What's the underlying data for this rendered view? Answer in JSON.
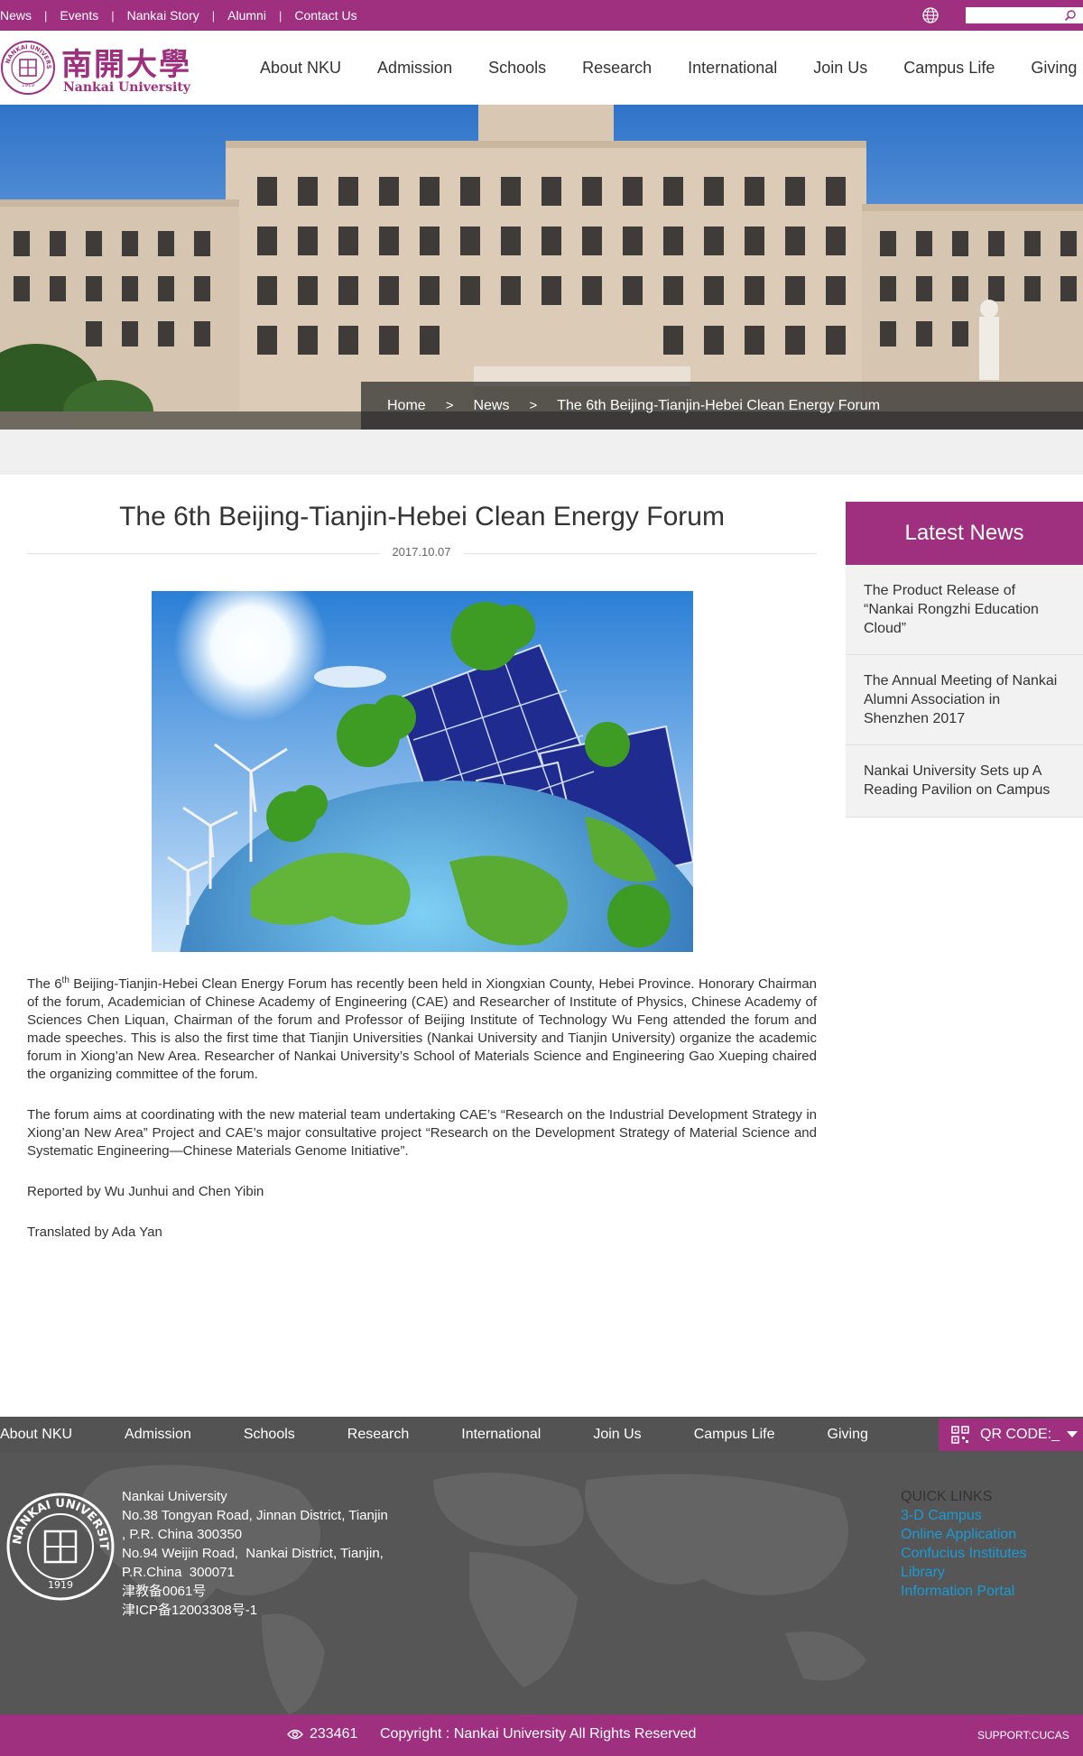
{
  "topbar": {
    "links": [
      "News",
      "Events",
      "Nankai Story",
      "Alumni",
      "Contact Us"
    ],
    "search_placeholder": ""
  },
  "header": {
    "logo_cn": "南開大學",
    "logo_en": "Nankai University",
    "seal_text": "NANKAI UNIVERSITY",
    "seal_year": "1919",
    "nav": [
      "About NKU",
      "Admission",
      "Schools",
      "Research",
      "International",
      "Join Us",
      "Campus Life",
      "Giving"
    ]
  },
  "breadcrumb": {
    "home": "Home",
    "sep1": ">",
    "section": "News",
    "sep2": ">",
    "current": "The 6th Beijing-Tianjin-Hebei Clean Energy Forum"
  },
  "article": {
    "title": "The 6th Beijing-Tianjin-Hebei Clean Energy Forum",
    "date": "2017.10.07",
    "p1_lead": "The 6",
    "p1_sup": "th",
    "p1_rest": " Beijing-Tianjin-Hebei Clean Energy Forum has recently been held in Xiongxian County, Hebei Province. Honorary Chairman of the forum, Academician of Chinese Academy of Engineering (CAE) and Researcher of Institute of Physics, Chinese Academy of Sciences Chen Liquan, Chairman of the forum and Professor of Beijing Institute of Technology Wu Feng attended the forum and made speeches. This is also the first time that Tianjin Universities (Nankai University and Tianjin University) organize the academic forum in Xiong’an New Area. Researcher of Nankai University’s School of Materials Science and Engineering Gao Xueping chaired the organizing committee of the forum.",
    "p2": "The forum aims at coordinating with the new material team undertaking CAE’s “Research on the Industrial Development Strategy in Xiong’an New Area” Project and CAE’s major consultative project “Research on the Development Strategy of Material Science and Systematic Engineering—Chinese Materials Genome Initiative”.",
    "reported_by": "Reported by Wu Junhui and Chen Yibin",
    "translated_by": "Translated by Ada Yan"
  },
  "sidebar": {
    "heading": "Latest News",
    "items": [
      "The Product Release of “Nankai Rongzhi Education Cloud”",
      "The Annual Meeting of Nankai Alumni Association in Shenzhen 2017",
      "Nankai University Sets up A Reading Pavilion on Campus"
    ]
  },
  "footer": {
    "nav": [
      "About NKU",
      "Admission",
      "Schools",
      "Research",
      "International",
      "Join Us",
      "Campus Life",
      "Giving"
    ],
    "qr_label": "QR CODE:_",
    "address": "Nankai University\nNo.38 Tongyan Road, Jinnan District, Tianjin\n, P.R. China 300350\nNo.94 Weijin Road,  Nankai District, Tianjin,\nP.R.China  300071\n津教备0061号\n津ICP备12003308号-1",
    "quick_links_title": "QUICK LINKS",
    "quick_links": [
      "3-D Campus",
      "Online Application",
      "Confucius Institutes",
      "Library",
      "Information Portal"
    ],
    "visits": "233461",
    "copyright": "Copyright : Nankai University All Rights Reserved",
    "support": "SUPPORT:CUCAS"
  },
  "colors": {
    "brand": "#9f2f7f",
    "footer_gray": "#565656",
    "link_blue": "#1a9bd7"
  }
}
